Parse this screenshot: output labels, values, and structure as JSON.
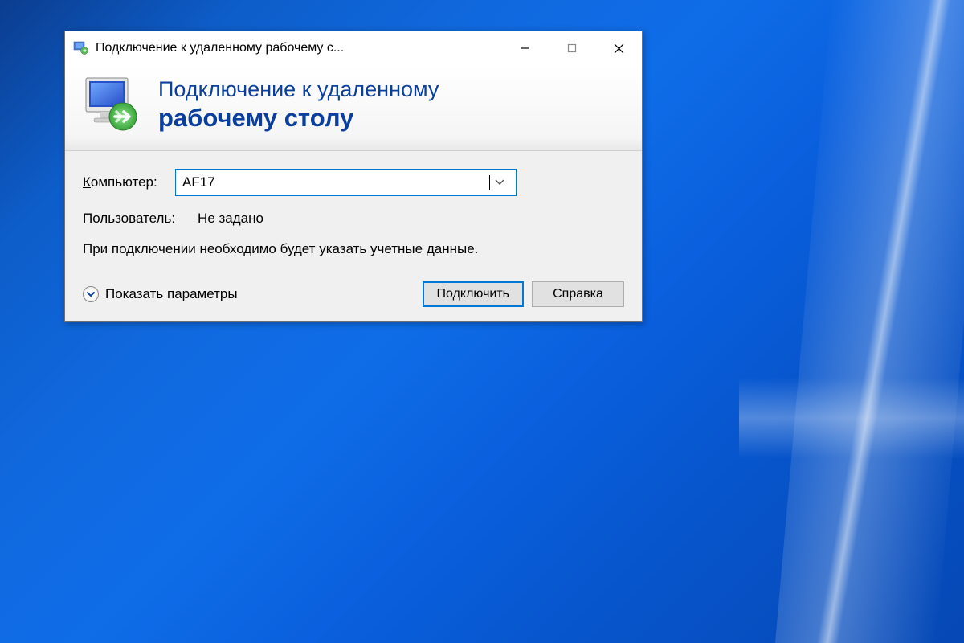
{
  "window": {
    "title": "Подключение к удаленному рабочему с..."
  },
  "header": {
    "line1": "Подключение к удаленному",
    "line2": "рабочему столу"
  },
  "form": {
    "computer_label_prefix": "К",
    "computer_label_suffix": "омпьютер:",
    "computer_value": "AF17",
    "user_label": "Пользователь:",
    "user_value": "Не задано",
    "info_text": "При подключении необходимо будет указать учетные данные."
  },
  "actions": {
    "show_options_prefix": "П",
    "show_options_suffix": "оказать параметры",
    "connect_prefix": "П",
    "connect_suffix": "одключить",
    "help_prefix": "С",
    "help_suffix": "правка"
  }
}
